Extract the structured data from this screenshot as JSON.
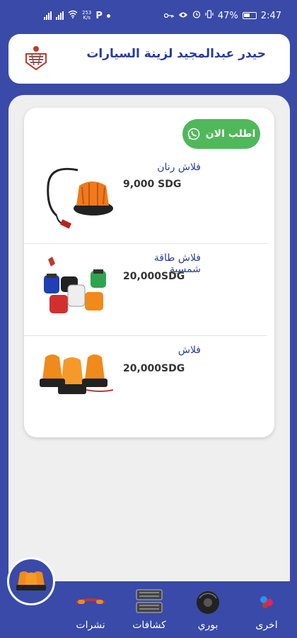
{
  "status_bar": {
    "network_speed_value": "253",
    "network_speed_unit": "K/s",
    "p_indicator": "P",
    "battery": "47%",
    "time": "2:47"
  },
  "header": {
    "title": "حيدر عبدالمجيد لزينة السيارات"
  },
  "order_button": {
    "label": "اطلب الان"
  },
  "products": [
    {
      "name": "فلاش رنان",
      "price": "9,000 SDG"
    },
    {
      "name": "فلاش طاقة شمسية",
      "price": "20,000SDG"
    },
    {
      "name": "فلاش",
      "price": "20,000SDG"
    }
  ],
  "bottom_nav": {
    "items": [
      {
        "label": "اخرى",
        "icon": "other-icon"
      },
      {
        "label": "بوري",
        "icon": "horn-icon"
      },
      {
        "label": "كشافات",
        "icon": "spotlight-icon"
      },
      {
        "label": "نشرات",
        "icon": "led-strip-icon"
      }
    ],
    "active_icon": "flash-beacon-icon"
  },
  "colors": {
    "primary": "#3a4aa8",
    "title_text": "#2a3b9a",
    "order_button": "#4fb85a",
    "background": "#efefef"
  }
}
